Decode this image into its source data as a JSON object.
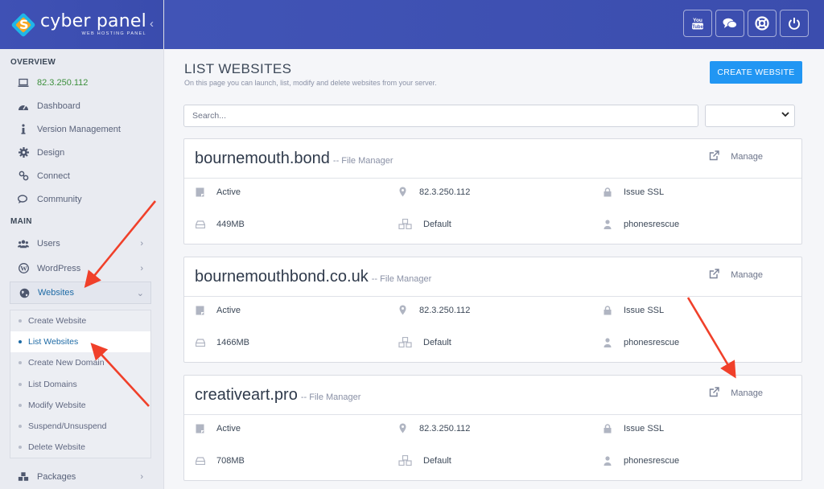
{
  "brand": {
    "name": "cyber panel",
    "tagline": "WEB HOSTING PANEL"
  },
  "sidebar": {
    "overview_title": "OVERVIEW",
    "overview_items": [
      {
        "label": "82.3.250.112",
        "icon": "laptop-icon"
      },
      {
        "label": "Dashboard",
        "icon": "dashboard-icon"
      },
      {
        "label": "Version Management",
        "icon": "info-icon"
      },
      {
        "label": "Design",
        "icon": "gear-icon"
      },
      {
        "label": "Connect",
        "icon": "link-icon"
      },
      {
        "label": "Community",
        "icon": "comments-icon"
      }
    ],
    "main_title": "MAIN",
    "main_items": [
      {
        "label": "Users",
        "icon": "users-icon"
      },
      {
        "label": "WordPress",
        "icon": "wordpress-icon"
      },
      {
        "label": "Websites",
        "icon": "globe-icon"
      }
    ],
    "websites_submenu": [
      {
        "label": "Create Website"
      },
      {
        "label": "List Websites"
      },
      {
        "label": "Create New Domain"
      },
      {
        "label": "List Domains"
      },
      {
        "label": "Modify Website"
      },
      {
        "label": "Suspend/Unsuspend"
      },
      {
        "label": "Delete Website"
      }
    ],
    "packages": {
      "label": "Packages",
      "icon": "cubes-icon"
    }
  },
  "topbar": {
    "buttons": [
      "youtube-icon",
      "chat-icon",
      "lifebuoy-icon",
      "power-icon"
    ]
  },
  "main": {
    "title": "LIST WEBSITES",
    "subtitle": "On this page you can launch, list, modify and delete websites from your server.",
    "create_button": "CREATE WEBSITE",
    "search_placeholder": "Search...",
    "filter_value": "",
    "file_manager_label": "-- File Manager",
    "manage_label": "Manage",
    "issue_ssl_label": "Issue SSL",
    "websites": [
      {
        "domain": "bournemouth.bond",
        "status": "Active",
        "ip": "82.3.250.112",
        "disk": "449MB",
        "package": "Default",
        "owner": "phonesrescue"
      },
      {
        "domain": "bournemouthbond.co.uk",
        "status": "Active",
        "ip": "82.3.250.112",
        "disk": "1466MB",
        "package": "Default",
        "owner": "phonesrescue"
      },
      {
        "domain": "creativeart.pro",
        "status": "Active",
        "ip": "82.3.250.112",
        "disk": "708MB",
        "package": "Default",
        "owner": "phonesrescue"
      }
    ]
  },
  "colors": {
    "header": "#3f51b5",
    "accent": "#2196f3",
    "arrow": "#f0402a",
    "ip_text": "#3c8f3c"
  }
}
